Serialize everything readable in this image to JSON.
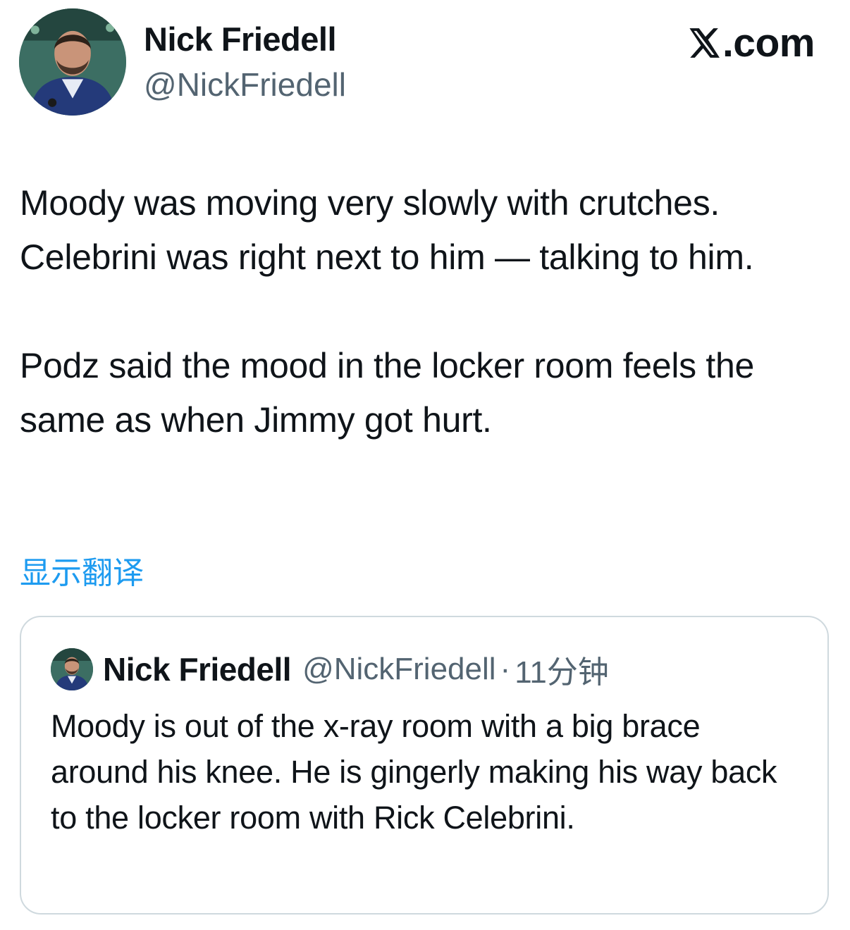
{
  "author": {
    "display_name": "Nick Friedell",
    "handle": "@NickFriedell"
  },
  "brand": {
    "icon": "x-logo-icon",
    "domain": ".com"
  },
  "tweet": {
    "paragraphs": [
      "Moody was moving very slowly with crutches. Celebrini was right next to him — talking to him.",
      "Podz said the mood in the locker room feels the same as when Jimmy got hurt."
    ],
    "translate_label": "显示翻译"
  },
  "quote": {
    "display_name": "Nick Friedell",
    "handle": "@NickFriedell",
    "separator": "·",
    "time": "11分钟",
    "text": "Moody is out of the x-ray room with a big brace around his knee. He is gingerly making his way back to the locker room with Rick Celebrini."
  },
  "colors": {
    "link": "#1d9bf0",
    "secondary_text": "#536471",
    "border": "#cfd9de",
    "primary_text": "#0f1419"
  }
}
